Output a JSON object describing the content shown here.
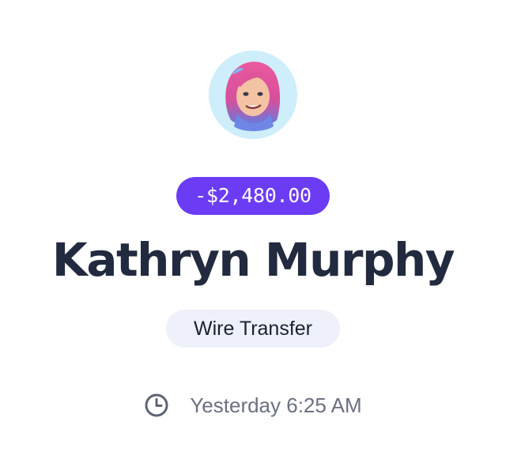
{
  "theme": {
    "accent": "#6c3cf5",
    "avatar_background": "#cdeefa"
  },
  "transaction": {
    "avatar_icon": "memoji-avatar",
    "amount": "-$2,480.00",
    "recipient_name": "Kathryn Murphy",
    "type": "Wire Transfer",
    "time_icon": "clock-icon",
    "timestamp": "Yesterday 6:25 AM"
  }
}
